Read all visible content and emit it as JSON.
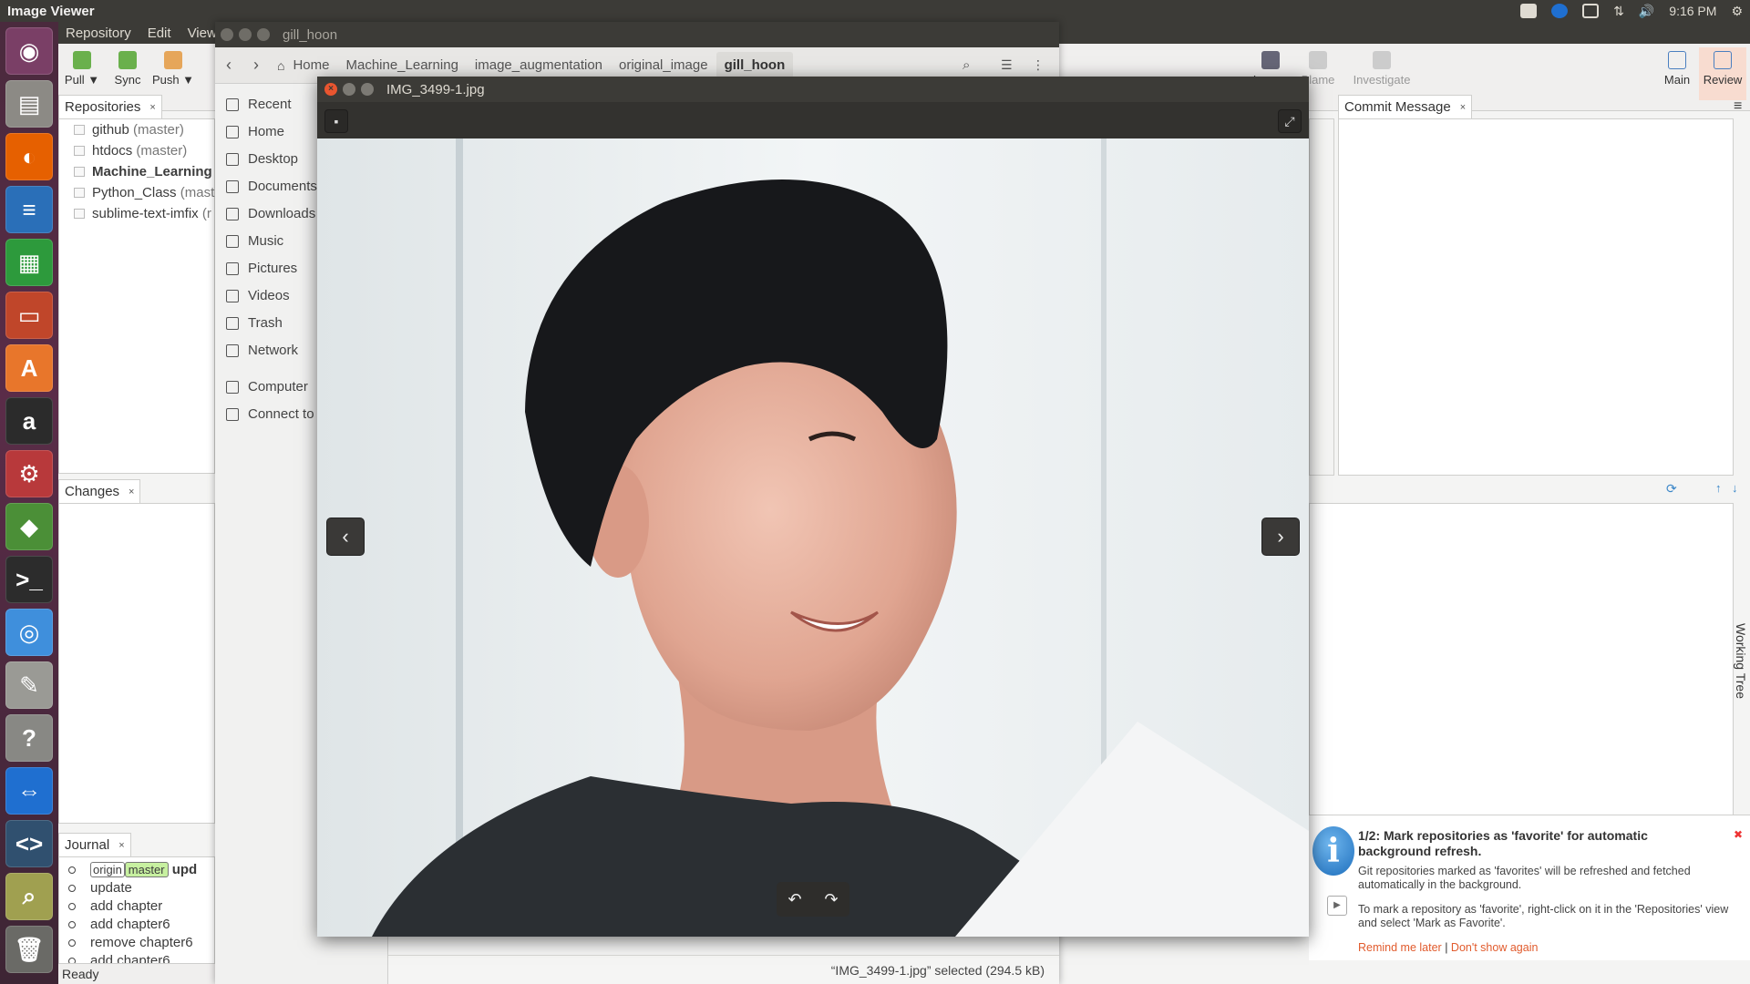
{
  "topbar": {
    "app_title": "Image Viewer",
    "time": "9:16 PM"
  },
  "launcher": {
    "items": [
      {
        "name": "ubuntu-dash-icon",
        "glyph": "◉",
        "color": "#7a3f66"
      },
      {
        "name": "files-icon",
        "glyph": "▤",
        "color": "#8c8a85"
      },
      {
        "name": "firefox-icon",
        "glyph": "◐",
        "color": "#e66000"
      },
      {
        "name": "writer-icon",
        "glyph": "≡",
        "color": "#2a6fb8"
      },
      {
        "name": "calc-icon",
        "glyph": "▦",
        "color": "#2d9a3c"
      },
      {
        "name": "impress-icon",
        "glyph": "▭",
        "color": "#c0462a"
      },
      {
        "name": "software-center-icon",
        "glyph": "A",
        "color": "#e8762b"
      },
      {
        "name": "amazon-icon",
        "glyph": "a",
        "color": "#2b2b2b"
      },
      {
        "name": "settings-icon",
        "glyph": "⚙",
        "color": "#b8393b"
      },
      {
        "name": "smartgit-icon",
        "glyph": "◆",
        "color": "#4b8f37"
      },
      {
        "name": "terminal-icon",
        "glyph": ">_",
        "color": "#2c2c2c"
      },
      {
        "name": "chrome-icon",
        "glyph": "◎",
        "color": "#3f8fdc"
      },
      {
        "name": "text-editor-icon",
        "glyph": "✎",
        "color": "#9a9a95"
      },
      {
        "name": "help-icon",
        "glyph": "?",
        "color": "#888884"
      },
      {
        "name": "teamviewer-icon",
        "glyph": "⇔",
        "color": "#1f6fd0"
      },
      {
        "name": "code-editor-icon",
        "glyph": "<>",
        "color": "#30506f"
      },
      {
        "name": "image-viewer-icon",
        "glyph": "⌕",
        "color": "#a0a050"
      },
      {
        "name": "trash-icon",
        "glyph": "🗑",
        "color": "#6a6a66"
      }
    ]
  },
  "smartgit": {
    "menu": [
      "Repository",
      "Edit",
      "View"
    ],
    "toolbar": {
      "pull": "Pull ▼",
      "sync": "Sync",
      "push": "Push ▼",
      "log": "Log ▼",
      "blame": "Blame",
      "investigate": "Investigate",
      "main": "Main",
      "review": "Review"
    },
    "repositories": {
      "tab_label": "Repositories",
      "items": [
        {
          "name": "github",
          "branch": "(master)",
          "bold": false
        },
        {
          "name": "htdocs",
          "branch": "(master)",
          "bold": false
        },
        {
          "name": "Machine_Learning",
          "branch": "(",
          "bold": true
        },
        {
          "name": "Python_Class",
          "branch": "(maste",
          "bold": false
        },
        {
          "name": "sublime-text-imfix",
          "branch": "(r",
          "bold": false
        }
      ]
    },
    "changes_tab": "Changes",
    "commit_message_tab": "Commit Message",
    "journal": {
      "tab_label": "Journal",
      "head": {
        "origin": "origin",
        "master": "master",
        "message": "upd"
      },
      "rows": [
        "update",
        "add chapter",
        "add chapter6",
        "remove chapter6",
        "add chapter6"
      ]
    },
    "working_tree_label": "Working Tree",
    "status": "Ready",
    "notification": {
      "title": "1/2: Mark repositories as 'favorite' for automatic background refresh.",
      "body1": "Git repositories marked as 'favorites' will be refreshed and fetched automatically in the background.",
      "body2": "To mark a repository as 'favorite', right-click on it in the 'Repositories' view and select 'Mark as Favorite'.",
      "remind": "Remind me later",
      "separator": "|",
      "dont_show": "Don't show again"
    }
  },
  "nautilus": {
    "title": "gill_hoon",
    "breadcrumbs": [
      "Home",
      "Machine_Learning",
      "image_augmentation",
      "original_image",
      "gill_hoon"
    ],
    "sidebar": [
      "Recent",
      "Home",
      "Desktop",
      "Documents",
      "Downloads",
      "Music",
      "Pictures",
      "Videos",
      "Trash",
      "Network"
    ],
    "sidebar_devices": [
      "Computer",
      "Connect to"
    ],
    "status": "“IMG_3499-1.jpg” selected  (294.5 kB)"
  },
  "viewer": {
    "title": "IMG_3499-1.jpg",
    "prev": "‹",
    "next": "›",
    "rotate_left": "↶",
    "rotate_right": "↷"
  }
}
